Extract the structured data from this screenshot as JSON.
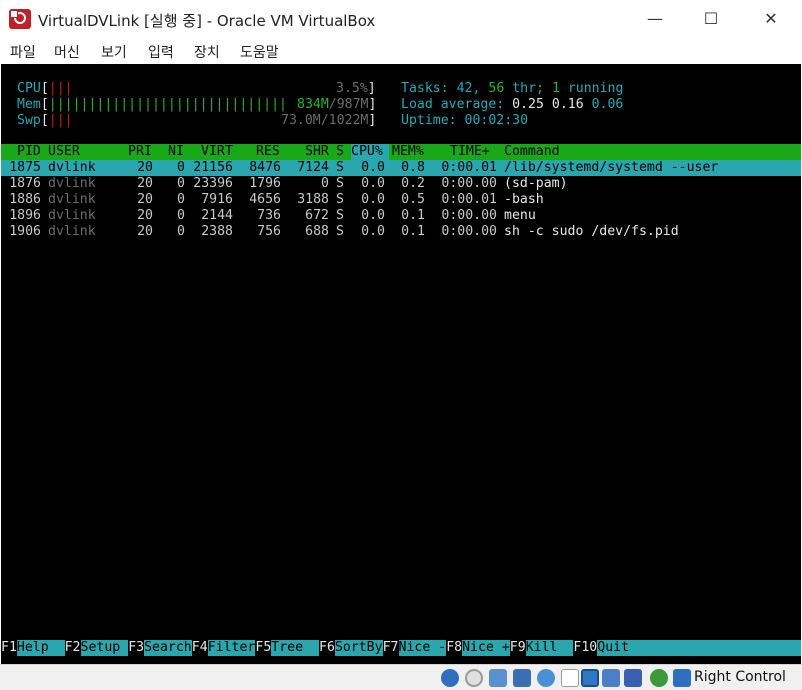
{
  "window": {
    "title": "VirtualDVLink [실행 중] - Oracle VM VirtualBox",
    "controls": {
      "minimize": "—",
      "maximize": "☐",
      "close": "✕"
    }
  },
  "menubar": {
    "items": [
      "파일",
      "머신",
      "보기",
      "입력",
      "장치",
      "도움말"
    ]
  },
  "htop": {
    "meters": {
      "cpu_label": "CPU",
      "cpu_bars": "|||",
      "cpu_value": "3.5%",
      "mem_label": "Mem",
      "mem_bars": "||||||||||||||||||||||||||||||",
      "mem_used": "834M",
      "mem_total": "987M",
      "swp_label": "Swp",
      "swp_bars": "|||",
      "swp_value": "73.0M/1022M"
    },
    "summary": {
      "tasks_label": "Tasks:",
      "tasks": "42",
      "threads": "56",
      "thr_label": "thr;",
      "running": "1",
      "running_label": "running",
      "load_label": "Load average:",
      "load1": "0.25",
      "load5": "0.16",
      "load15": "0.06",
      "uptime_label": "Uptime:",
      "uptime": "00:02:30"
    },
    "columns": [
      "PID",
      "USER",
      "PRI",
      "NI",
      "VIRT",
      "RES",
      "SHR",
      "S",
      "CPU%",
      "MEM%",
      "TIME+",
      "Command"
    ],
    "processes": [
      {
        "pid": "1875",
        "user": "dvlink",
        "pri": "20",
        "ni": "0",
        "virt": "21156",
        "res": "8476",
        "shr": "7124",
        "s": "S",
        "cpu": "0.0",
        "mem": "0.8",
        "time": "0:00.01",
        "cmd": "/lib/systemd/systemd --user"
      },
      {
        "pid": "1876",
        "user": "dvlink",
        "pri": "20",
        "ni": "0",
        "virt": "23396",
        "res": "1796",
        "shr": "0",
        "s": "S",
        "cpu": "0.0",
        "mem": "0.2",
        "time": "0:00.00",
        "cmd": "(sd-pam)"
      },
      {
        "pid": "1886",
        "user": "dvlink",
        "pri": "20",
        "ni": "0",
        "virt": "7916",
        "res": "4656",
        "shr": "3188",
        "s": "S",
        "cpu": "0.0",
        "mem": "0.5",
        "time": "0:00.01",
        "cmd": "-bash"
      },
      {
        "pid": "1896",
        "user": "dvlink",
        "pri": "20",
        "ni": "0",
        "virt": "2144",
        "res": "736",
        "shr": "672",
        "s": "S",
        "cpu": "0.0",
        "mem": "0.1",
        "time": "0:00.00",
        "cmd": "menu"
      },
      {
        "pid": "1906",
        "user": "dvlink",
        "pri": "20",
        "ni": "0",
        "virt": "2388",
        "res": "756",
        "shr": "688",
        "s": "S",
        "cpu": "0.0",
        "mem": "0.1",
        "time": "0:00.00",
        "cmd": "sh -c sudo /dev/fs.pid"
      }
    ],
    "function_keys": [
      {
        "key": "F1",
        "label": "Help  "
      },
      {
        "key": "F2",
        "label": "Setup "
      },
      {
        "key": "F3",
        "label": "Search"
      },
      {
        "key": "F4",
        "label": "Filter"
      },
      {
        "key": "F5",
        "label": "Tree  "
      },
      {
        "key": "F6",
        "label": "SortBy"
      },
      {
        "key": "F7",
        "label": "Nice -"
      },
      {
        "key": "F8",
        "label": "Nice +"
      },
      {
        "key": "F9",
        "label": "Kill  "
      },
      {
        "key": "F10",
        "label": "Quit"
      }
    ]
  },
  "statusbar": {
    "host_key": "Right Control",
    "icons": [
      "optical-disc-icon",
      "cd-icon",
      "audio-icon",
      "network-icon",
      "usb-icon",
      "shared-folder-icon",
      "display-icon",
      "recording-icon",
      "virtualization-icon",
      "mouse-integration-icon",
      "keyboard-capture-icon"
    ]
  },
  "colors": {
    "header_bg": "#18a818",
    "selection_bg": "#2aa6ae",
    "terminal_bg": "#000000",
    "meter_label": "#26a9b8"
  }
}
